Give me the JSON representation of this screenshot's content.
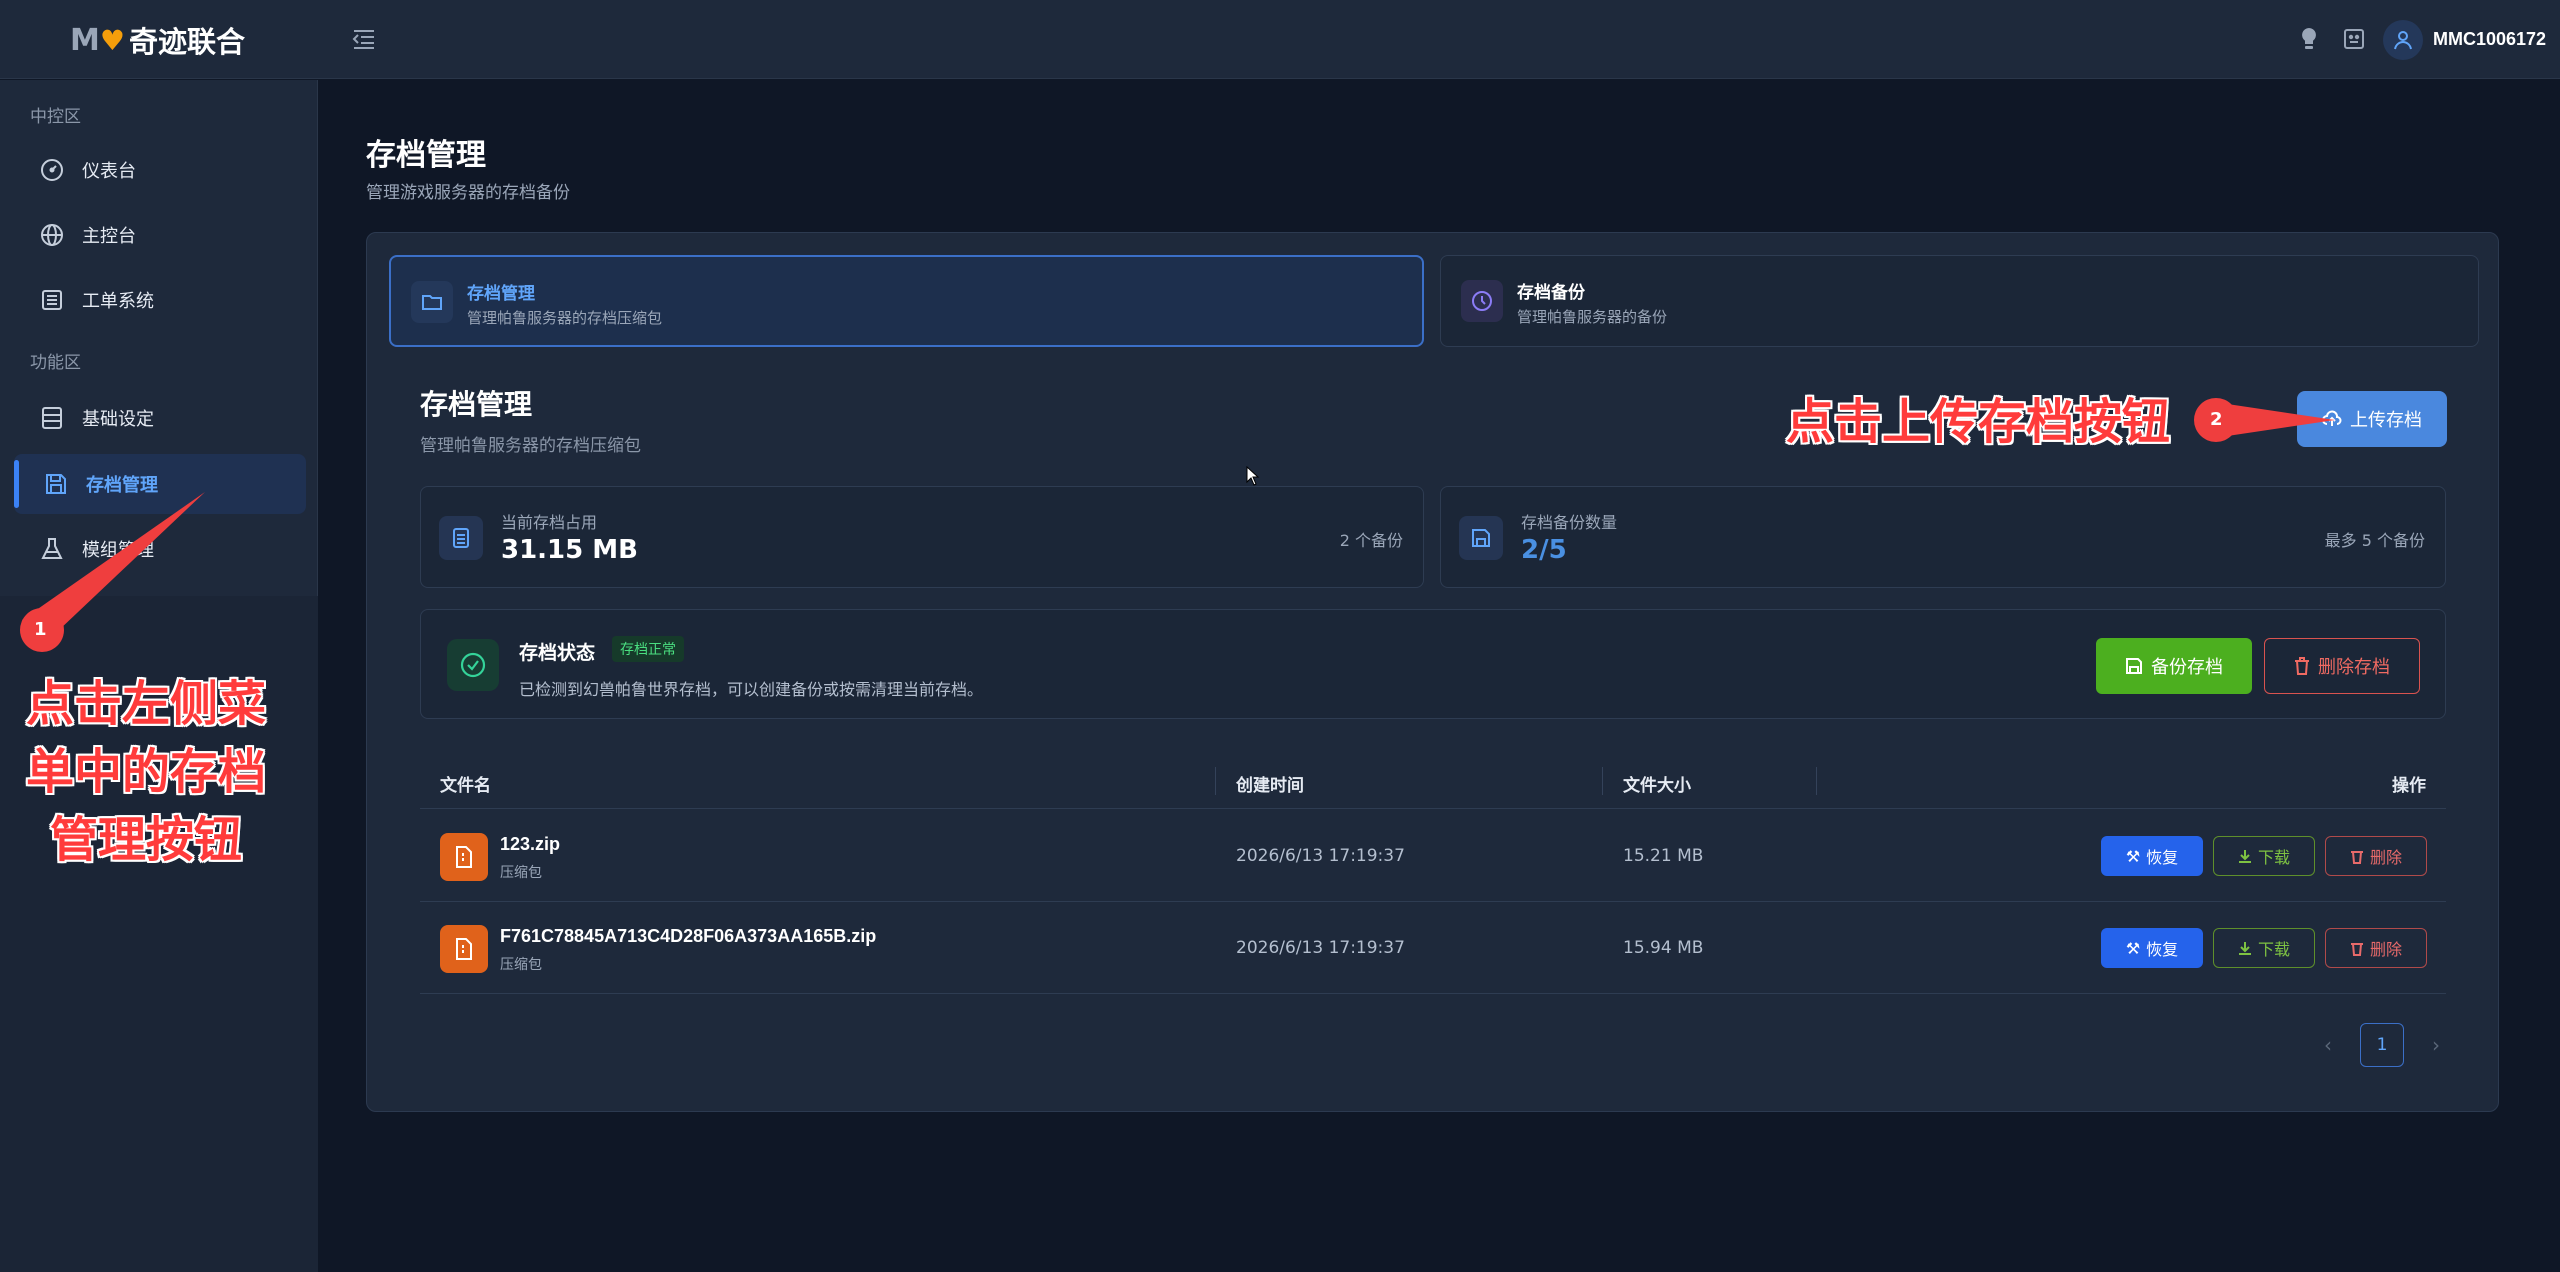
{
  "header": {
    "logo_mark": "M",
    "logo_text": "奇迹联合",
    "username": "MMC1006172"
  },
  "sidebar": {
    "section_1": "中控区",
    "section_2": "功能区",
    "items": [
      {
        "label": "仪表台",
        "icon": "gauge-icon"
      },
      {
        "label": "主控台",
        "icon": "globe-icon"
      },
      {
        "label": "工单系统",
        "icon": "list-icon"
      },
      {
        "label": "基础设定",
        "icon": "server-icon"
      },
      {
        "label": "存档管理",
        "icon": "save-icon"
      },
      {
        "label": "模组管理",
        "icon": "flask-icon"
      }
    ]
  },
  "page": {
    "title": "存档管理",
    "subtitle": "管理游戏服务器的存档备份"
  },
  "tabs": [
    {
      "title": "存档管理",
      "subtitle": "管理帕鲁服务器的存档压缩包"
    },
    {
      "title": "存档备份",
      "subtitle": "管理帕鲁服务器的备份"
    }
  ],
  "section": {
    "title": "存档管理",
    "subtitle": "管理帕鲁服务器的存档压缩包",
    "upload_label": "上传存档"
  },
  "stats": [
    {
      "label": "当前存档占用",
      "value": "31.15 MB",
      "right": "2 个备份"
    },
    {
      "label": "存档备份数量",
      "value": "2/5",
      "right": "最多 5 个备份"
    }
  ],
  "status": {
    "title": "存档状态",
    "badge": "存档正常",
    "desc": "已检测到幻兽帕鲁世界存档，可以创建备份或按需清理当前存档。",
    "backup_label": "备份存档",
    "delete_label": "删除存档"
  },
  "table": {
    "headers": [
      "文件名",
      "创建时间",
      "文件大小",
      "操作"
    ],
    "rows": [
      {
        "name": "123.zip",
        "type": "压缩包",
        "time": "2026/6/13 17:19:37",
        "size": "15.21 MB"
      },
      {
        "name": "F761C78845A713C4D28F06A373AA165B.zip",
        "type": "压缩包",
        "time": "2026/6/13 17:19:37",
        "size": "15.94 MB"
      }
    ],
    "actions": {
      "restore": "恢复",
      "download": "下载",
      "delete": "删除"
    }
  },
  "pagination": {
    "current": "1"
  },
  "annotations": {
    "badge_1": "1",
    "badge_2": "2",
    "left_text_1": "点击左侧菜",
    "left_text_2": "单中的存档",
    "left_text_3": "管理按钮",
    "top_text": "点击上传存档按钮"
  },
  "colors": {
    "accent": "#3b82f6",
    "success": "#4caf1f",
    "danger": "#d9534f",
    "file_icon": "#e0621b",
    "annotation": "#ff3b3b"
  }
}
